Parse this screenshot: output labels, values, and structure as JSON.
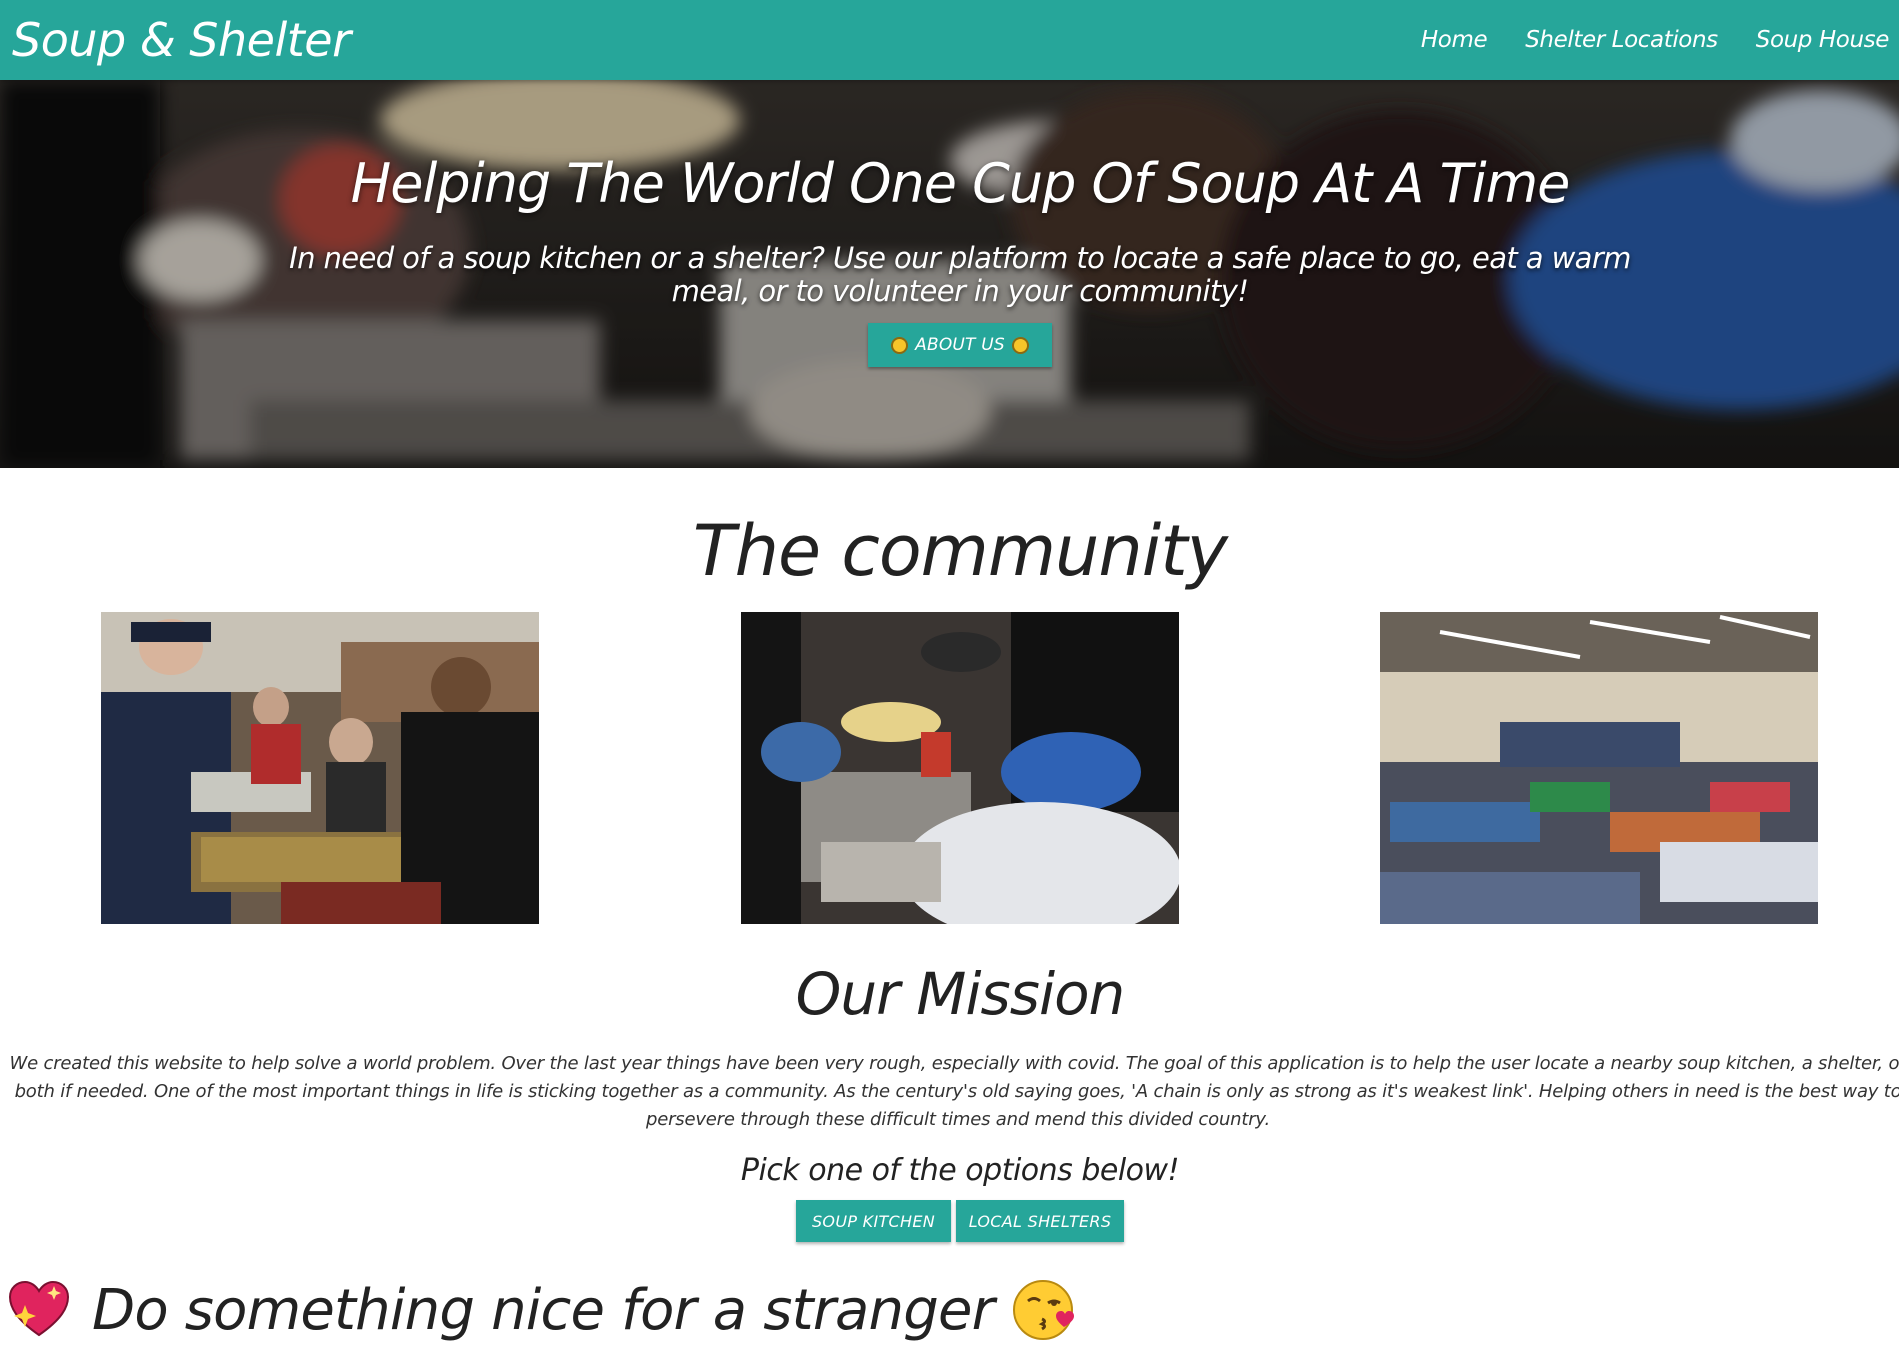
{
  "navbar": {
    "brand": "Soup & Shelter",
    "links": [
      "Home",
      "Shelter Locations",
      "Soup House"
    ]
  },
  "hero": {
    "title": "Helping The World One Cup Of Soup At A Time",
    "subtitle": "In need of a soup kitchen or a shelter? Use our platform to locate a safe place to go, eat a warm meal, or to volunteer in your community!",
    "button_label": "ABOUT US",
    "button_icon": "sun-icon"
  },
  "community": {
    "title": "The community",
    "photos": [
      "serving-line-photo",
      "food-donation-photo",
      "shelter-cots-photo"
    ]
  },
  "mission": {
    "title": "Our Mission",
    "text": "We created this website to help solve a world problem. Over the last year things have been very rough, especially with covid. The goal of this application is to help the user locate a nearby soup kitchen, a shelter, or both if needed. One of the most important things in life is sticking together as a community. As the century's old saying goes, 'A chain is only as strong as it's weakest link'. Helping others in need is the best way to persevere through these difficult times and mend this divided country.",
    "pick_text": "Pick one of the options below!",
    "buttons": [
      "SOUP KITCHEN",
      "LOCAL SHELTERS"
    ]
  },
  "footer_line": {
    "text": "Do something nice for a stranger",
    "left_icon": "sparkling-heart-icon",
    "right_icon": "face-blowing-kiss-icon"
  },
  "colors": {
    "primary": "#26a69a",
    "text": "#222222"
  }
}
